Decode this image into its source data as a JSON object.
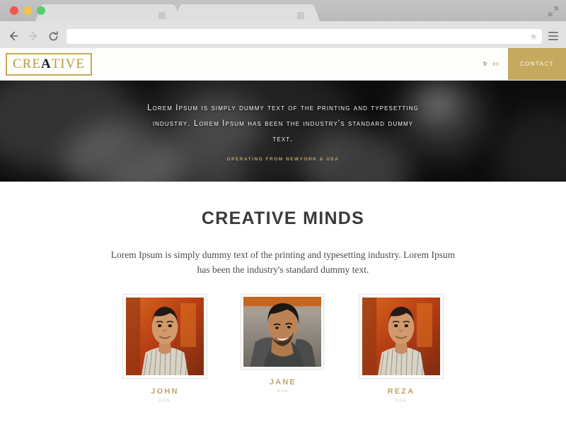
{
  "browser": {
    "tabs": [
      {
        "title": ""
      },
      {
        "title": ""
      }
    ],
    "nav": {
      "back_label": "←",
      "forward_label": "→",
      "reload_label": "⟳",
      "menu_label": "menu"
    },
    "address_bar": {
      "value": "",
      "placeholder": ""
    },
    "icons": {
      "bookmark": "★",
      "expand": "⤡"
    },
    "window_controls": {
      "close_color": "#f2554d",
      "minimize_color": "#f2c24c",
      "zoom_color": "#54ce6f"
    }
  },
  "site": {
    "header": {
      "logo": {
        "part1": "CRE",
        "accent": "A",
        "part2": "TIVE"
      },
      "languages": [
        {
          "code": "fr",
          "active": false
        },
        {
          "code": "en",
          "active": true
        }
      ],
      "contact_label": "CONTACT",
      "accent_color": "#c4a95f"
    },
    "hero": {
      "headline": "Lorem Ipsum is simply dummy text of the printing and typesetting industry. Lorem Ipsum has been the industry's standard dummy text.",
      "subline": "OPERATING FROM NEWYORK & USA",
      "subline_color": "#bfa263",
      "background_color": "#0d0d0d"
    },
    "main": {
      "title": "CREATIVE MINDS",
      "paragraph": "Lorem Ipsum is simply dummy text of the printing and typesetting industry. Lorem Ipsum has been the industry's standard dummy text.",
      "team": [
        {
          "name": "JOHN",
          "role": "DOE"
        },
        {
          "name": "JANE",
          "role": "DOE"
        },
        {
          "name": "REZA",
          "role": "DOE"
        }
      ],
      "name_color": "#bfa569"
    }
  }
}
